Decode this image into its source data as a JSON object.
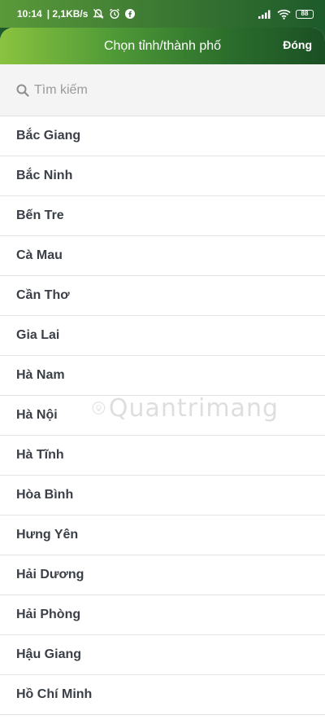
{
  "status_bar": {
    "time": "10:14",
    "network_speed": "| 2,1KB/s",
    "battery_level": "88",
    "icons": [
      "mute-icon",
      "alarm-icon",
      "facebook-icon",
      "signal-icon",
      "wifi-icon",
      "battery-icon"
    ]
  },
  "header": {
    "title": "Chọn tỉnh/thành phố",
    "close_label": "Đóng"
  },
  "search": {
    "placeholder": "Tìm kiếm",
    "value": ""
  },
  "provinces": [
    "Bắc Giang",
    "Bắc Ninh",
    "Bến Tre",
    "Cà Mau",
    "Cần Thơ",
    "Gia Lai",
    "Hà Nam",
    "Hà Nội",
    "Hà Tĩnh",
    "Hòa Bình",
    "Hưng Yên",
    "Hải Dương",
    "Hải Phòng",
    "Hậu Giang",
    "Hồ Chí Minh"
  ],
  "watermark": "Quantrimang",
  "colors": {
    "header_start": "#8ac33f",
    "header_end": "#1b4f24",
    "list_text": "#3a3f47",
    "divider": "#e3e3e3",
    "search_bg": "#f4f4f4"
  }
}
